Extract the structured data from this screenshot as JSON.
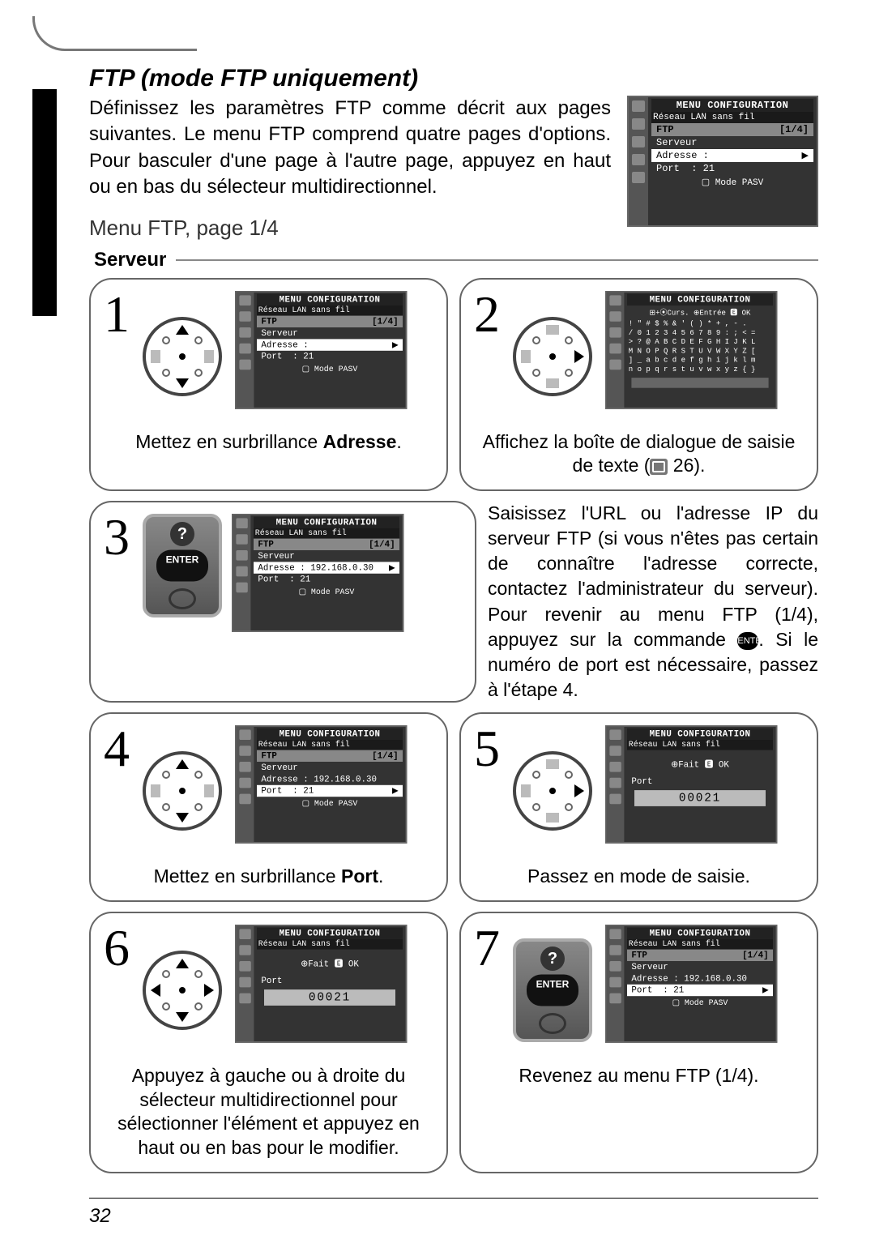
{
  "page_number": "32",
  "section_title": "FTP (mode FTP uniquement)",
  "intro_text": "Définissez les paramètres FTP comme décrit aux pages suivantes. Le menu FTP comprend quatre pages d'options. Pour basculer d'une page à l'autre page, appuyez en haut ou en bas du sélecteur multidirectionnel.",
  "sub_heading": "Menu FTP, page 1/4",
  "serveur_label": "Serveur",
  "lcd_common": {
    "title": "MENU CONFIGURATION",
    "subtitle": "Réseau LAN sans fil",
    "tab": "FTP",
    "page": "[1/4]",
    "row_serveur": "Serveur",
    "row_port_label": "Port",
    "row_port_value": "21",
    "footer": "Mode PASV"
  },
  "lcd1_addr": "Adresse :",
  "lcd3_addr": "Adresse : 192.168.0.30",
  "lcd_text_entry": {
    "hint": "⊞+⦿Curs.  ⊕Entrée 🅴 OK",
    "line1": "! \" # $ % & ' ( ) * + , - .",
    "line2": "/ 0 1 2 3 4 5 6 7 8 9 : ; < =",
    "line3": "> ? @ A B C D E F G H I J K L",
    "line4": "M N O P Q R S T U V W X Y Z [",
    "line5": "] _ a b c d e f g h i j k l m",
    "line6": "n o p q r s t u v w x y z { }"
  },
  "lcd_port_entry": {
    "hint": "⊕Fait    🅴 OK",
    "label": "Port",
    "value": "00021"
  },
  "steps": {
    "s1": {
      "num": "1",
      "caption_pre": "Mettez en surbrillance ",
      "caption_bold": "Adresse",
      "caption_post": "."
    },
    "s2": {
      "num": "2",
      "caption_pre": "Affichez la boîte de dialogue de saisie de texte (",
      "ref": " 26).",
      "icon_label": "book-icon"
    },
    "s3": {
      "num": "3",
      "text": "Saisissez l'URL ou l'adresse IP du serveur FTP (si vous n'êtes pas certain de connaître l'adresse correcte, contactez l'administrateur du serveur). Pour revenir au menu FTP (1/4), appuyez sur la commande ",
      "text_after": ". Si le numéro de port est nécessaire, passez à l'étape 4.",
      "btn_label": "ENTER"
    },
    "s4": {
      "num": "4",
      "caption_pre": "Mettez en surbrillance ",
      "caption_bold": "Port",
      "caption_post": "."
    },
    "s5": {
      "num": "5",
      "caption": "Passez en mode de saisie."
    },
    "s6": {
      "num": "6",
      "caption": "Appuyez à gauche ou à droite du sélecteur multidirectionnel pour sélectionner l'élément et appuyez en haut ou en bas pour le modifier."
    },
    "s7": {
      "num": "7",
      "caption": "Revenez au menu FTP (1/4).",
      "btn_label": "ENTER"
    }
  }
}
